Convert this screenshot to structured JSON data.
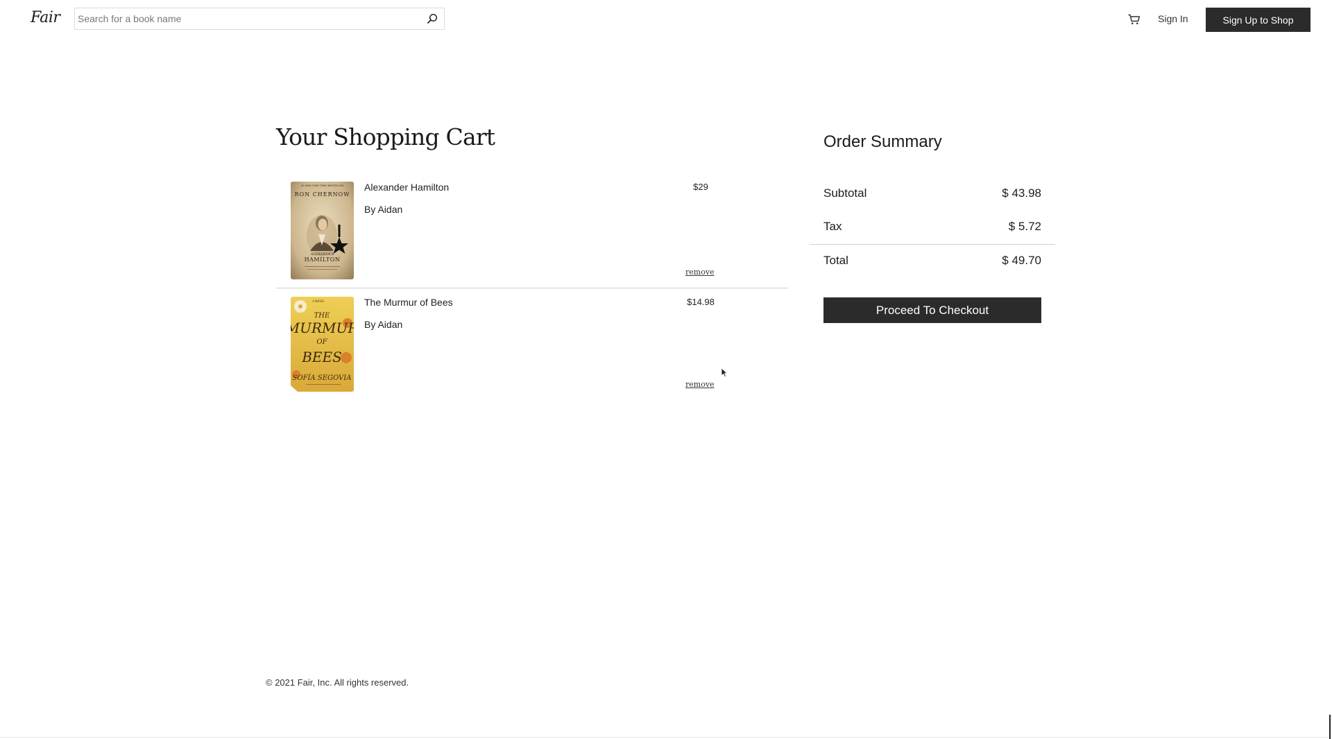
{
  "header": {
    "logo_text": "Fair",
    "search_placeholder": "Search for a book name",
    "search_icon": "search-icon",
    "cart_icon": "cart-icon",
    "sign_in_label": "Sign In",
    "signup_label": "Sign Up to Shop"
  },
  "cart": {
    "title": "Your Shopping Cart",
    "items": [
      {
        "title": "Alexander Hamilton",
        "author": "By Aidan",
        "price": "$29",
        "remove_label": "remove",
        "cover": {
          "top_text": "#1 NEW YORK TIMES BESTSELLER",
          "author": "RON CHERNOW",
          "title_line1": "ALEXANDER",
          "title_line2": "HAMILTON"
        }
      },
      {
        "title": "The Murmur of Bees",
        "author": "By Aidan",
        "price": "$14.98",
        "remove_label": "remove",
        "cover": {
          "top_text": "A NOVEL",
          "word_the": "THE",
          "word_murmur": "MURMUR",
          "word_of": "OF",
          "word_bees": "BEES",
          "author": "SOFÍA SEGOVIA"
        }
      }
    ]
  },
  "summary": {
    "title": "Order Summary",
    "subtotal_label": "Subtotal",
    "subtotal_value": "$ 43.98",
    "tax_label": "Tax",
    "tax_value": "$ 5.72",
    "total_label": "Total",
    "total_value": "$ 49.70",
    "checkout_label": "Proceed To Checkout"
  },
  "footer": {
    "copyright": "© 2021 Fair, Inc. All rights reserved."
  },
  "colors": {
    "dark_button": "#2b2b2b",
    "cover_hamilton": "#d8c6a1",
    "cover_bees": "#e9c24a"
  }
}
